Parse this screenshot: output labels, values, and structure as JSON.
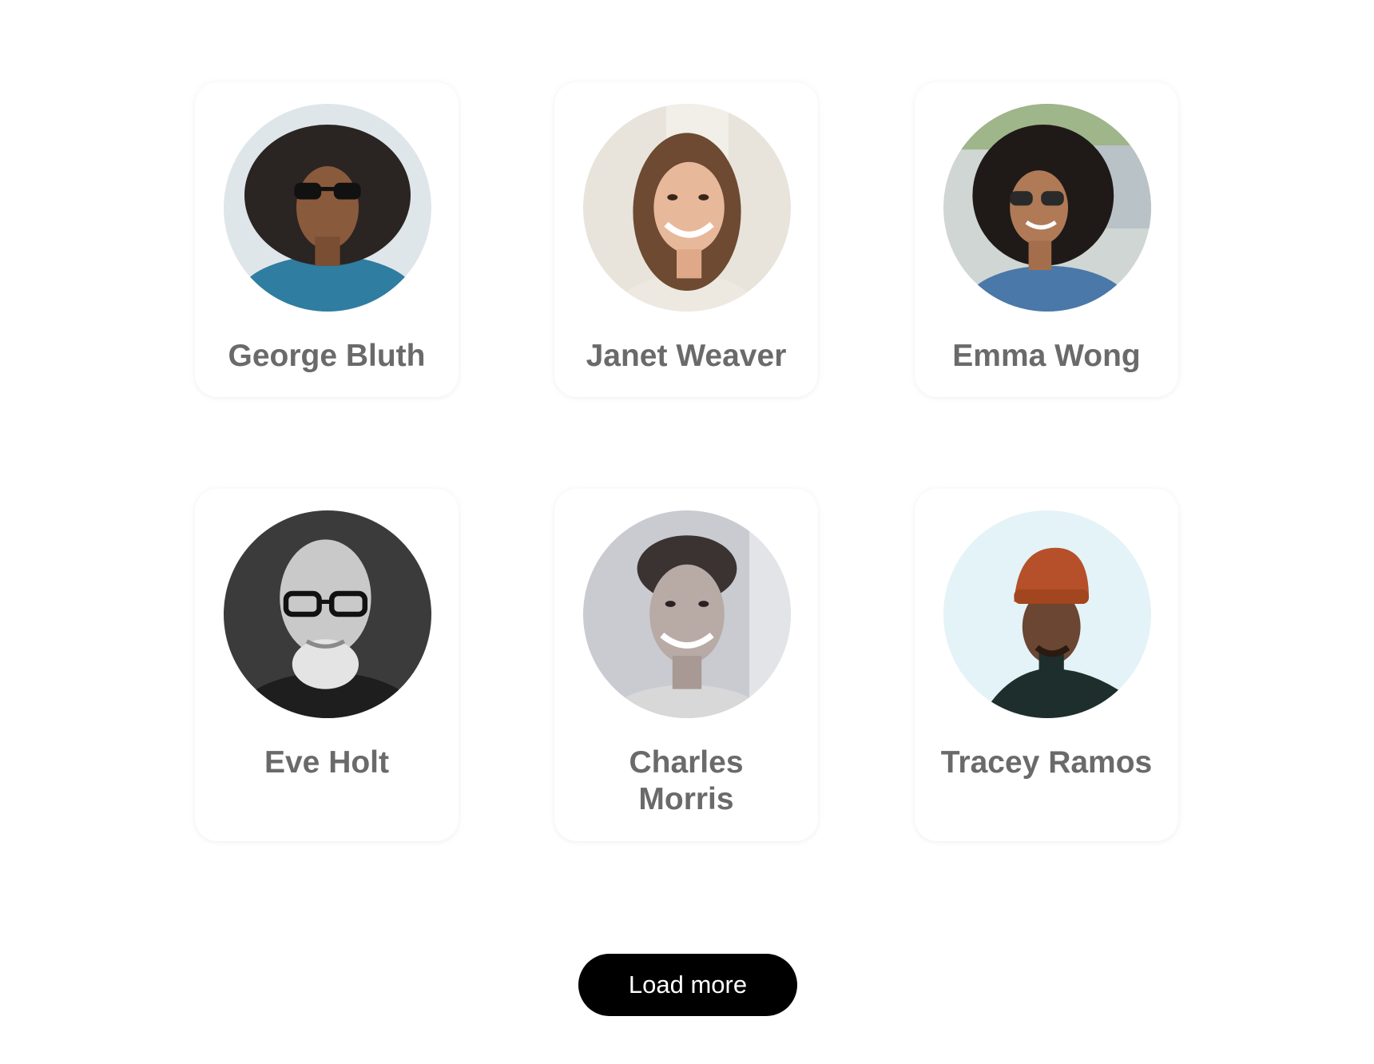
{
  "users": [
    {
      "name": "George Bluth",
      "avatar_icon": "avatar-photo-george-bluth-icon"
    },
    {
      "name": "Janet Weaver",
      "avatar_icon": "avatar-photo-janet-weaver-icon"
    },
    {
      "name": "Emma Wong",
      "avatar_icon": "avatar-photo-emma-wong-icon"
    },
    {
      "name": "Eve Holt",
      "avatar_icon": "avatar-photo-eve-holt-icon"
    },
    {
      "name": "Charles Morris",
      "avatar_icon": "avatar-photo-charles-morris-icon"
    },
    {
      "name": "Tracey Ramos",
      "avatar_icon": "avatar-photo-tracey-ramos-icon"
    }
  ],
  "load_more": {
    "label": "Load more"
  },
  "colors": {
    "name_text": "#6a6a6a",
    "button_bg": "#000000",
    "button_text": "#ffffff",
    "card_bg": "#ffffff"
  }
}
